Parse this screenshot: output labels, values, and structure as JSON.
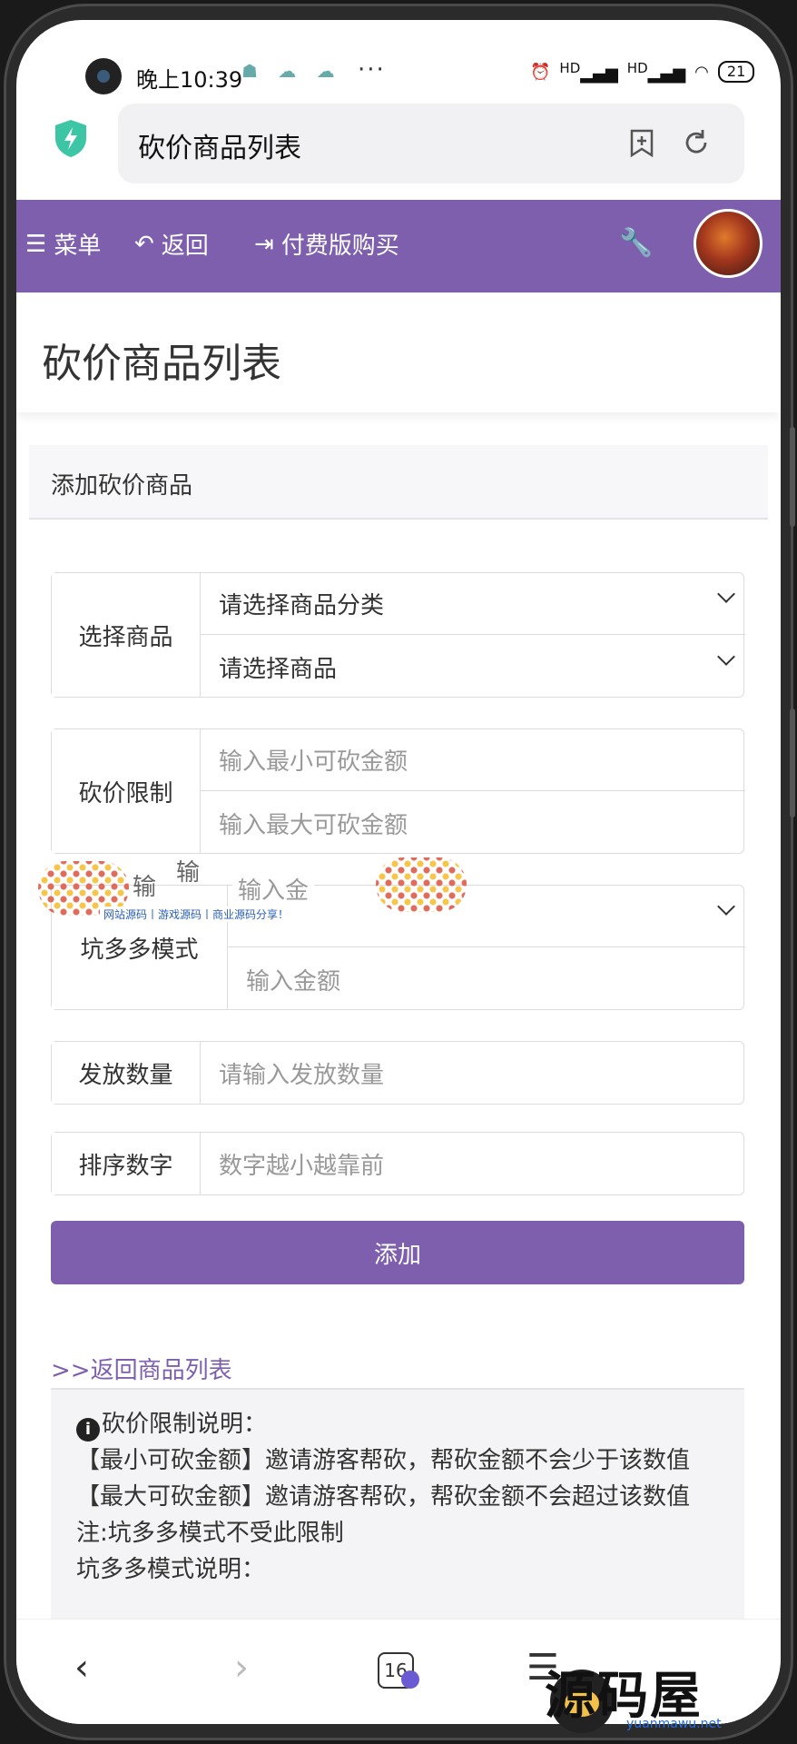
{
  "status_bar": {
    "time": "晚上10:39",
    "signal1": "HD",
    "signal2": "HD",
    "battery": "21"
  },
  "browser": {
    "url_title": "砍价商品列表",
    "tab_count": "16"
  },
  "nav": {
    "menu": "菜单",
    "back": "返回",
    "buy": "付费版购买"
  },
  "page": {
    "title": "砍价商品列表",
    "card_title": "添加砍价商品"
  },
  "form": {
    "select_goods_label": "选择商品",
    "select_category": "请选择商品分类",
    "select_goods": "请选择商品",
    "limit_label": "砍价限制",
    "min_placeholder": "输入最小可砍金额",
    "max_placeholder": "输入最大可砍金额",
    "pdd_label": "坑多多模式",
    "pdd_amount_placeholder": "输入金额",
    "pdd_amount_placeholder_partial": "输入金",
    "quantity_label": "发放数量",
    "quantity_placeholder": "请输入发放数量",
    "sort_label": "排序数字",
    "sort_placeholder": "数字越小越靠前",
    "add_button": "添加"
  },
  "links": {
    "back_list": ">>返回商品列表"
  },
  "notes": {
    "title": "砍价限制说明：",
    "line1": "【最小可砍金额】邀请游客帮砍，帮砍金额不会少于该数值",
    "line2": "【最大可砍金额】邀请游客帮砍，帮砍金额不会超过该数值",
    "line3": "注:坑多多模式不受此限制",
    "line4": "坑多多模式说明："
  },
  "overlay": {
    "banner": "网站源码丨游戏源码丨商业源码分享！",
    "fragment1": "输",
    "fragment2": "输"
  },
  "watermark": {
    "main": "源码屋",
    "sub": "yuanmawu.net"
  }
}
